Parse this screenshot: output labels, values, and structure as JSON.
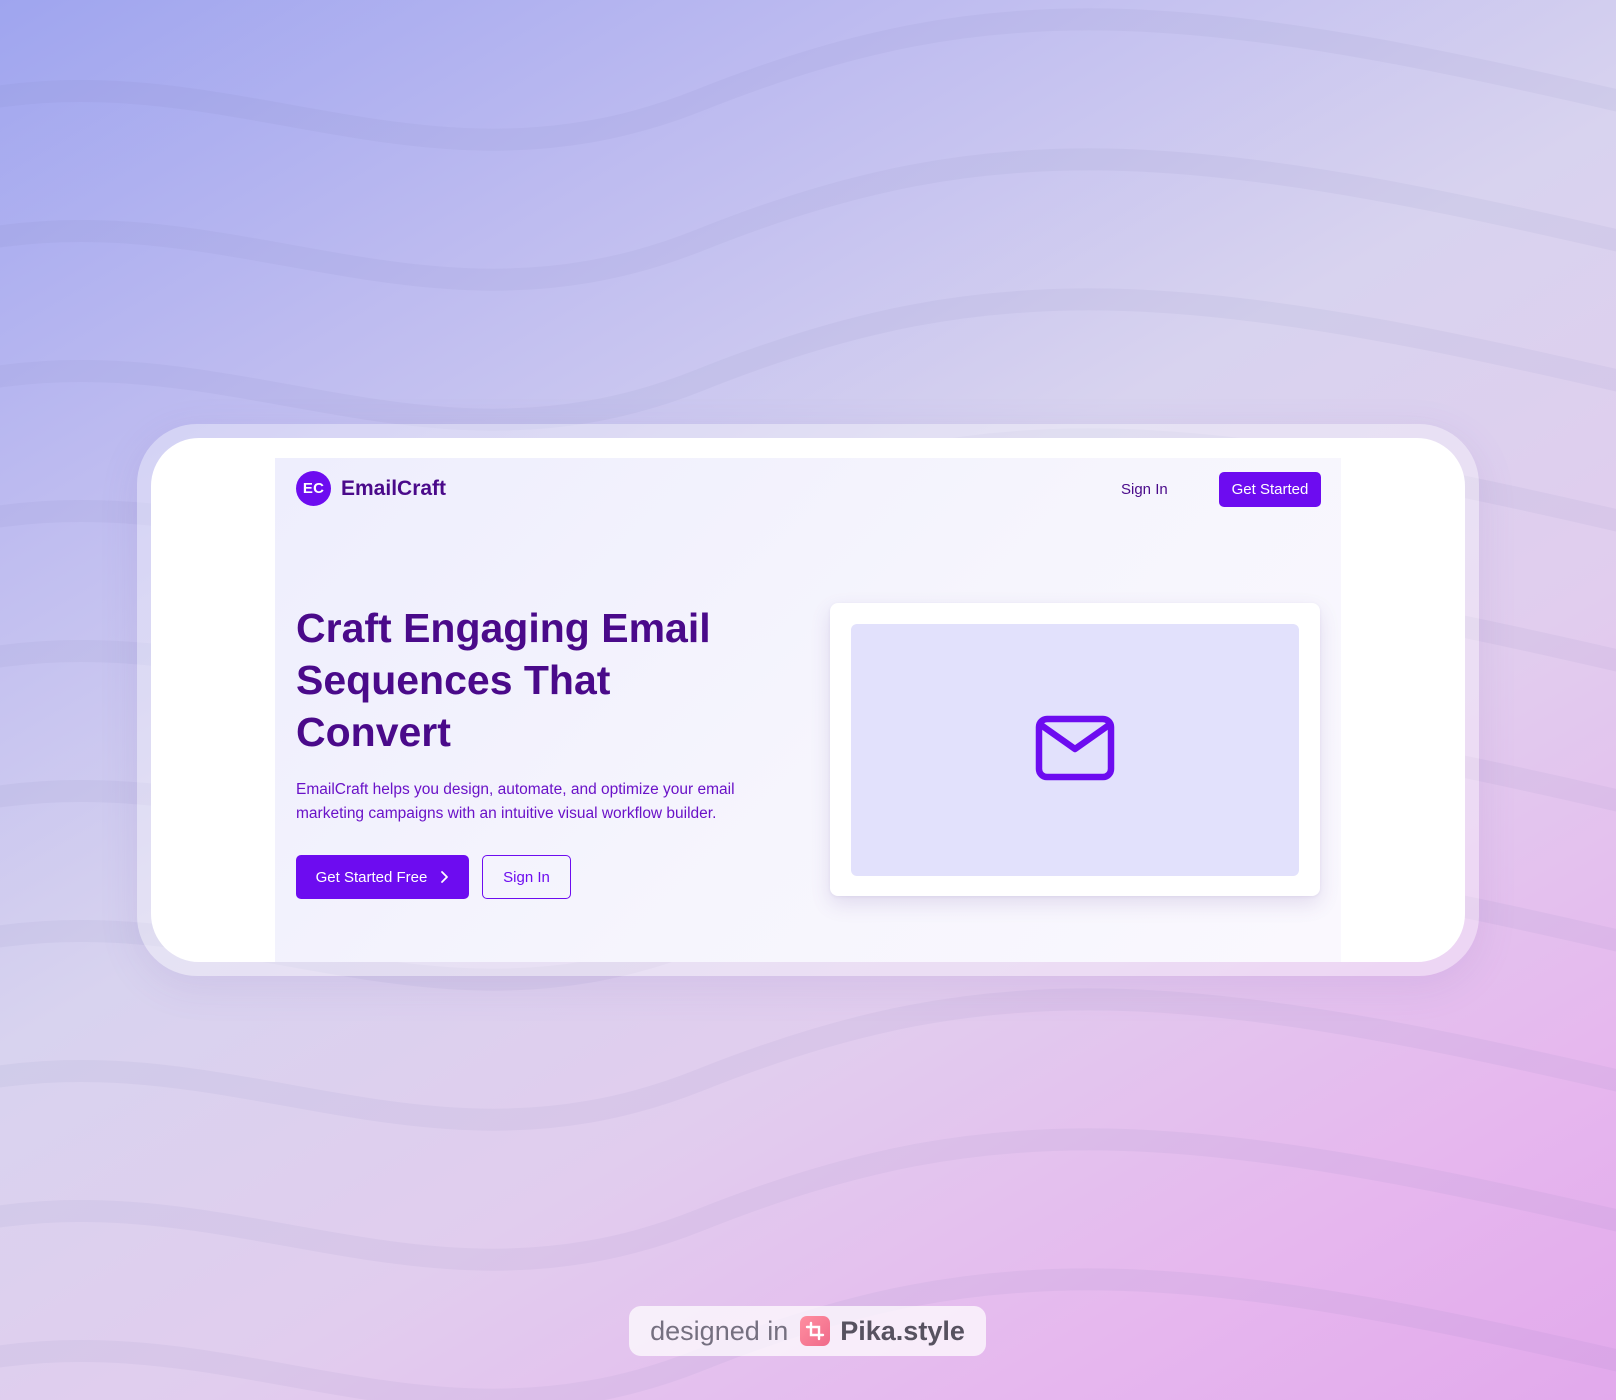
{
  "nav": {
    "logo_initials": "EC",
    "brand_name": "EmailCraft",
    "sign_in_label": "Sign In",
    "get_started_label": "Get Started"
  },
  "hero": {
    "title": "Craft Engaging Email Sequences That Convert",
    "description": "EmailCraft helps you design, automate, and optimize your email marketing campaigns with an intuitive visual workflow builder.",
    "primary_cta_label": "Get Started Free",
    "secondary_cta_label": "Sign In"
  },
  "preview": {
    "icon": "mail-icon"
  },
  "watermark": {
    "prefix": "designed in",
    "brand": "Pika.style"
  },
  "colors": {
    "accent": "#6d0cf0",
    "heading": "#4a0a8a",
    "preview_bg": "#e2e1fc"
  }
}
